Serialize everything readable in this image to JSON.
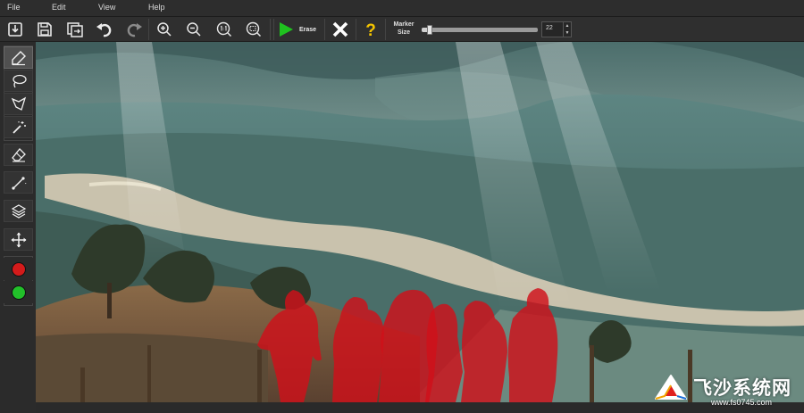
{
  "menubar": {
    "items": [
      "File",
      "Edit",
      "View",
      "Help"
    ]
  },
  "toolbar": {
    "buttons": [
      "open-icon",
      "save-icon",
      "export-icon",
      "undo-icon",
      "redo-icon",
      "zoom-in-icon",
      "zoom-out-icon",
      "actual-size-icon",
      "fit-to-window-icon"
    ],
    "erase_label": "Erase",
    "marker_label": "Marker Size",
    "marker_size": "22",
    "marker_size_fraction": 0.05
  },
  "tools": [
    {
      "name": "marker-tool",
      "icon": "marker-pen-icon",
      "active": true
    },
    {
      "name": "lasso-tool",
      "icon": "lasso-icon"
    },
    {
      "name": "polygon-lasso-tool",
      "icon": "polygon-lasso-icon"
    },
    {
      "name": "magic-wand-tool",
      "icon": "magic-wand-icon"
    },
    {
      "name": "eraser-tool",
      "icon": "eraser-icon"
    },
    {
      "name": "line-tool",
      "icon": "line-icon"
    },
    {
      "name": "layers-tool",
      "icon": "layers-icon"
    },
    {
      "name": "move-tool",
      "icon": "move-icon"
    },
    {
      "name": "red-marker-color",
      "icon": "red-circle-icon",
      "color": "#d41b1b"
    },
    {
      "name": "green-marker-color",
      "icon": "green-circle-icon",
      "color": "#22c02a"
    }
  ],
  "colors": {
    "erase_green": "#1fc21f",
    "selection_red": "#d0101a",
    "help_yellow": "#f4c400"
  },
  "watermark": {
    "text": "飞沙系统网",
    "url": "www.fs0745.com"
  }
}
